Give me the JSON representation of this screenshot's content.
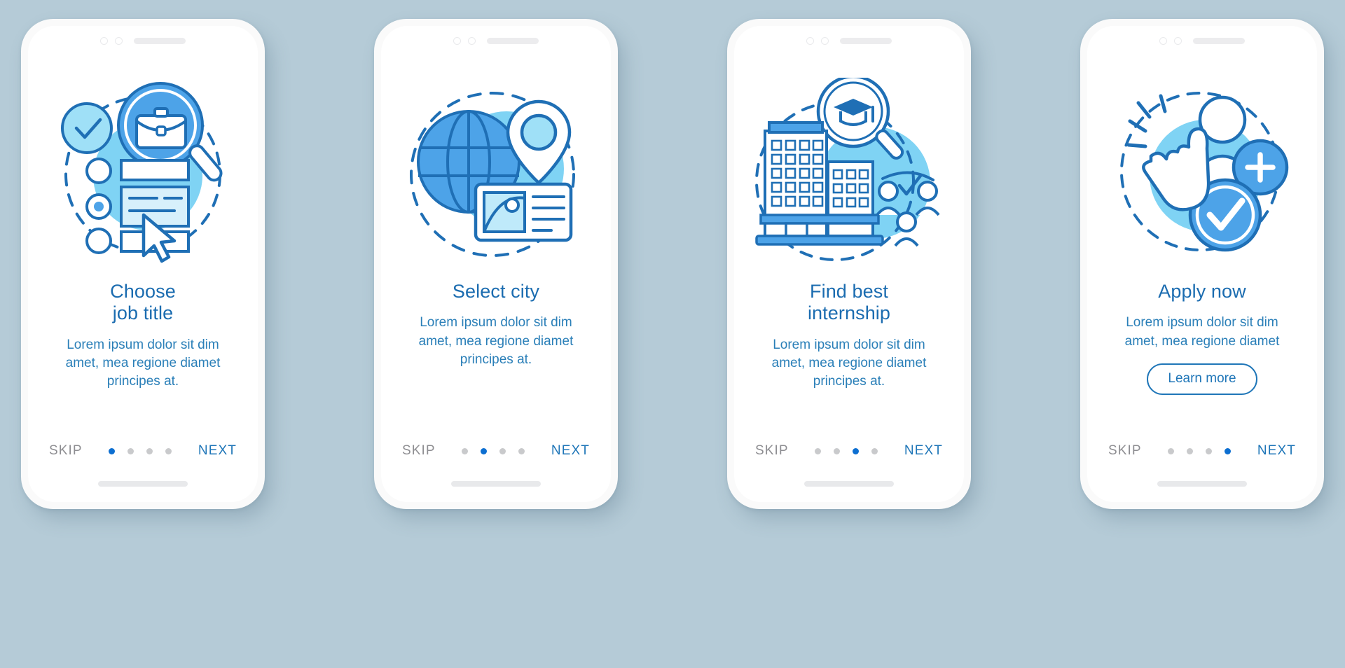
{
  "theme": {
    "background": "#b5cbd7",
    "phone_body": "#fafafa",
    "screen": "#ffffff",
    "title_color": "#1b6cb0",
    "desc_color": "#2a7fb8",
    "skip_color": "#8e8e92",
    "next_color": "#1f76b8",
    "dot_active": "#0d6fd1",
    "dot_inactive": "#c9cacc",
    "accent_light": "#7fd3f4",
    "accent_mid": "#4da3e8",
    "accent_dark": "#1f6fb5"
  },
  "nav": {
    "skip_label": "SKIP",
    "next_label": "NEXT",
    "dot_count": 4
  },
  "screens": [
    {
      "id": "choose-job-title",
      "title_lines": [
        "Choose",
        "job title"
      ],
      "description_lines": [
        "Lorem ipsum dolor sit dim",
        "amet, mea regione diamet",
        "principes at."
      ],
      "active_dot": 1,
      "illustration": "briefcase-magnifier-checklist",
      "cta": null
    },
    {
      "id": "select-city",
      "title_lines": [
        "Select city"
      ],
      "description_lines": [
        "Lorem ipsum dolor sit dim",
        "amet, mea regione diamet",
        "principes at."
      ],
      "active_dot": 2,
      "illustration": "globe-pin-card",
      "cta": null
    },
    {
      "id": "find-best-internship",
      "title_lines": [
        "Find best",
        "internship"
      ],
      "description_lines": [
        "Lorem ipsum dolor sit dim",
        "amet, mea regione diamet",
        "principes at."
      ],
      "active_dot": 3,
      "illustration": "buildings-graduation-people",
      "cta": null
    },
    {
      "id": "apply-now",
      "title_lines": [
        "Apply now"
      ],
      "description_lines": [
        "Lorem ipsum dolor sit dim",
        "amet, mea regione diamet"
      ],
      "active_dot": 4,
      "illustration": "cursor-person-check",
      "cta": "Learn more"
    }
  ]
}
